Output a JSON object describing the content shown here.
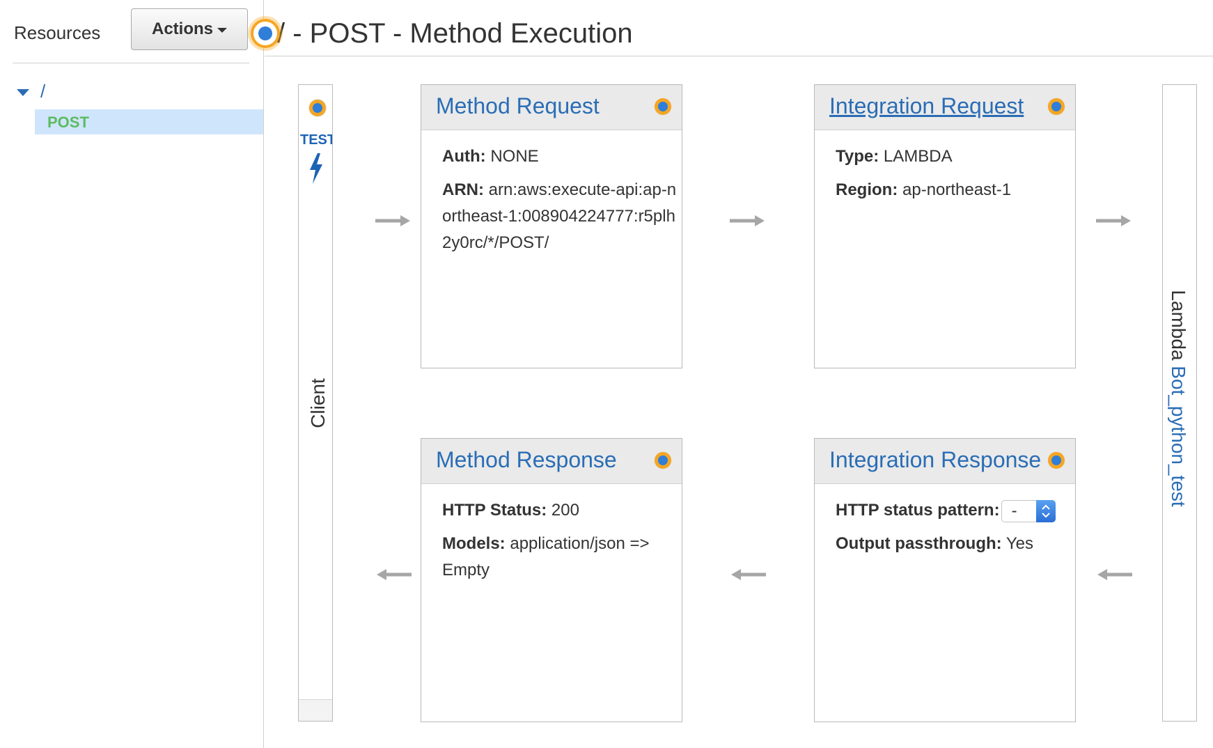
{
  "sidebar": {
    "title": "Resources",
    "actions_label": "Actions",
    "tree": {
      "root": "/",
      "items": [
        {
          "label": "POST",
          "selected": true
        }
      ]
    }
  },
  "header": {
    "title": "/ - POST - Method Execution"
  },
  "client": {
    "test_label": "TEST",
    "label": "Client"
  },
  "method_request": {
    "title": "Method Request",
    "auth_key": "Auth:",
    "auth_value": "NONE",
    "arn_key": "ARN:",
    "arn_value": "arn:aws:execute-api:ap-northeast-1:008904224777:r5plh2y0rc/*/POST/"
  },
  "integration_request": {
    "title": "Integration Request",
    "type_key": "Type:",
    "type_value": "LAMBDA",
    "region_key": "Region:",
    "region_value": "ap-northeast-1"
  },
  "method_response": {
    "title": "Method Response",
    "status_key": "HTTP Status:",
    "status_value": "200",
    "models_key": "Models:",
    "models_value": "application/json => Empty"
  },
  "integration_response": {
    "title": "Integration Response",
    "pattern_key": "HTTP status pattern:",
    "pattern_value": "-",
    "passthrough_key": "Output passthrough:",
    "passthrough_value": "Yes"
  },
  "lambda": {
    "prefix": "Lambda",
    "function_name": "Bot_python_test"
  },
  "colors": {
    "link_blue": "#2a6db5",
    "post_green": "#5dbb63",
    "selection_bg": "#cfe5fb",
    "highlight_orange": "#f5a623",
    "info_blue": "#2f7ed8"
  }
}
